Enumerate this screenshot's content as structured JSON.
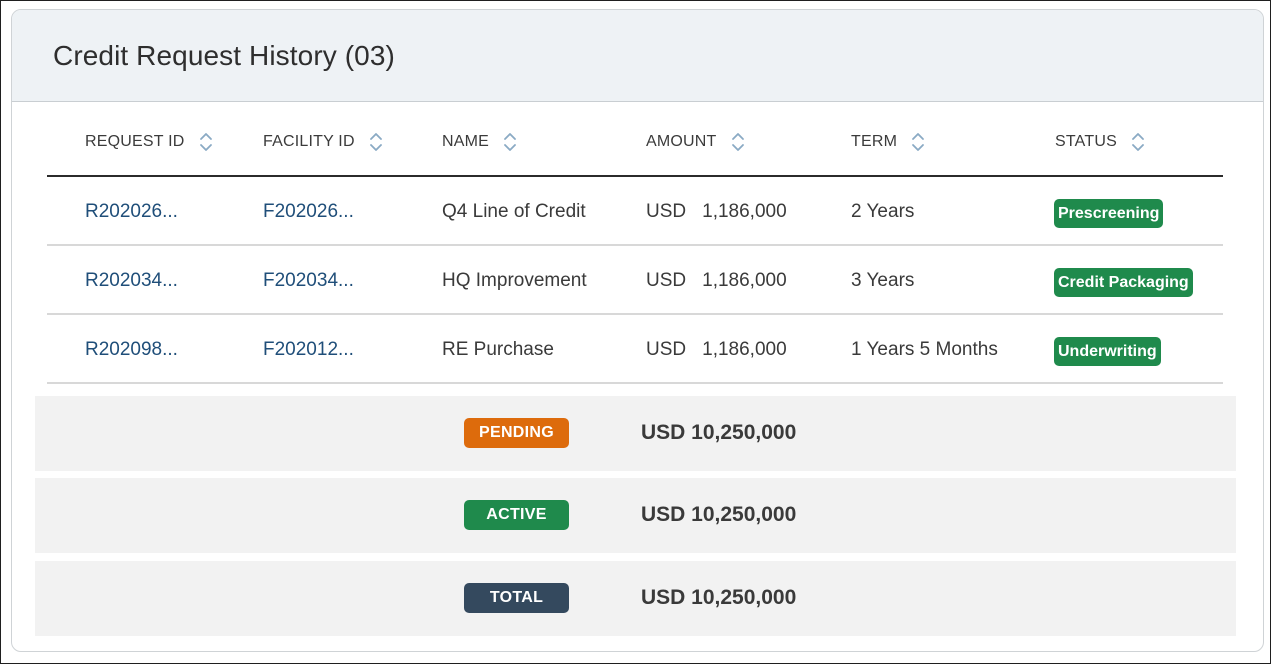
{
  "title": "Credit Request History (03)",
  "columns": [
    {
      "label": "REQUEST ID"
    },
    {
      "label": "FACILITY ID"
    },
    {
      "label": "NAME"
    },
    {
      "label": "AMOUNT"
    },
    {
      "label": "TERM"
    },
    {
      "label": "STATUS"
    }
  ],
  "rows": [
    {
      "request_id": "R202026...",
      "facility_id": "F202026...",
      "name": "Q4 Line of Credit",
      "currency": "USD",
      "amount": "1,186,000",
      "term": "2 Years",
      "status": "Prescreening"
    },
    {
      "request_id": "R202034...",
      "facility_id": "F202034...",
      "name": "HQ Improvement",
      "currency": "USD",
      "amount": "1,186,000",
      "term": "3 Years",
      "status": "Credit Packaging"
    },
    {
      "request_id": "R202098...",
      "facility_id": "F202012...",
      "name": "RE Purchase",
      "currency": "USD",
      "amount": "1,186,000",
      "term": "1 Years 5 Months",
      "status": "Underwriting"
    }
  ],
  "summary": [
    {
      "label": "PENDING",
      "value": "USD 10,250,000",
      "color": "#dd6b0c"
    },
    {
      "label": "ACTIVE",
      "value": "USD 10,250,000",
      "color": "#1f8a4c"
    },
    {
      "label": "TOTAL",
      "value": "USD 10,250,000",
      "color": "#34495e"
    }
  ],
  "colors": {
    "link": "#1f4e79",
    "status_badge": "#1f8a4c",
    "sort_icon": "#8aaac4"
  },
  "icons": {
    "sort": "sort-up-down-icon"
  }
}
